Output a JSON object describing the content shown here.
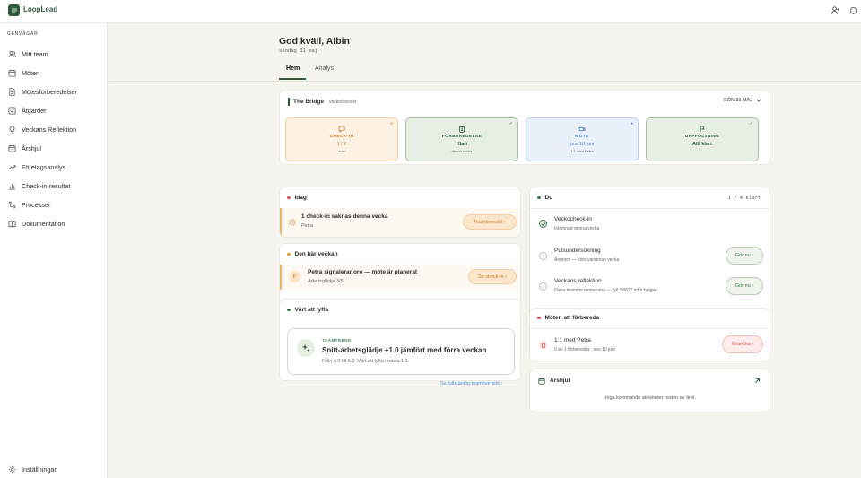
{
  "app": {
    "brand": "LoopLead"
  },
  "topbar": {
    "icons": [
      "add-user-icon",
      "bell-icon"
    ]
  },
  "sidebar": {
    "heading": "GENVÄGAR",
    "items": [
      {
        "label": "Mitt team",
        "icon": "users-icon"
      },
      {
        "label": "Möten",
        "icon": "calendar-icon"
      },
      {
        "label": "Mötesförberedelser",
        "icon": "document-icon"
      },
      {
        "label": "Åtgärder",
        "icon": "checkbox-icon"
      },
      {
        "label": "Veckans Reflektion",
        "icon": "lightbulb-icon"
      },
      {
        "label": "Årshjul",
        "icon": "calendar-icon"
      },
      {
        "label": "Företagsanalys",
        "icon": "trend-icon"
      },
      {
        "label": "Check-in-resultat",
        "icon": "bar-chart-icon"
      },
      {
        "label": "Processer",
        "icon": "process-icon"
      },
      {
        "label": "Dokumentation",
        "icon": "book-icon"
      }
    ],
    "settings": "Inställningar"
  },
  "header": {
    "greeting": "God kväll, Albin",
    "date": "söndag 31 maj",
    "tabs": [
      "Hem",
      "Analys"
    ]
  },
  "week": {
    "team": "The Bridge",
    "subtitle": "veckoöversikt",
    "date_select": "SÖN 31 MAJ",
    "cards": [
      {
        "title": "CHECK-IN",
        "value": "1 / 2",
        "sub": "svar",
        "mark": "●"
      },
      {
        "title": "FÖRBEREDELSE",
        "value": "Klart",
        "sub": "denna vecka",
        "mark": "✓"
      },
      {
        "title": "MÖTE",
        "value": "ons 10 juni",
        "sub": "1:1 med Petra",
        "mark": "●"
      },
      {
        "title": "UPPFÖLJNING",
        "value": "Allt klart",
        "sub": "",
        "mark": "✓"
      }
    ]
  },
  "today": {
    "title": "Idag",
    "item_title": "1 check-in saknas denna vecka",
    "item_sub": "Petra",
    "button": "Teamöversikt ›"
  },
  "this_week": {
    "title": "Den här veckan",
    "avatar": "P",
    "item_title": "Petra signalerar oro — möte är planerat",
    "item_sub": "Arbetsglädje 3/5",
    "button": "Se check-in ›"
  },
  "lift": {
    "title": "Värt att lyfta",
    "kicker": "TEAMTREND",
    "headline": "Snitt-arbetsglädje +1.0 jämfört med förra veckan",
    "detail": "Från 4.0 till 5.0. Värt att lyfta i nästa 1:1.",
    "link": "Se fullständig teamöversikt ›"
  },
  "du": {
    "title": "Du",
    "progress": "1 / 4 klart",
    "items": [
      {
        "title": "Veckocheck-in",
        "sub": "Inlämnad denna vecka",
        "done": true,
        "button": ""
      },
      {
        "title": "Pulsundersökning",
        "sub": "Anonym — körs varannan vecka",
        "done": false,
        "button": "Gör nu ›"
      },
      {
        "title": "Veckans reflektion",
        "sub": "Dissa teamets temperatur — fyll SWOT inför helgen",
        "done": false,
        "button": "Gör nu ›"
      }
    ]
  },
  "meetings": {
    "title": "Möten att förbereda",
    "item_title": "1:1 med Petra",
    "item_sub": "0 av 1 förberedda · ons 10 juni",
    "button": "Granska ›"
  },
  "wheel": {
    "title": "Årshjul",
    "empty": "Inga kommande aktiviteter resten av året."
  },
  "colors": {
    "brand": "#2f5a3c",
    "orange": "#e39a3c",
    "red": "#d9534f",
    "blue": "#5d8fd6",
    "green": "#3f7a4f"
  }
}
